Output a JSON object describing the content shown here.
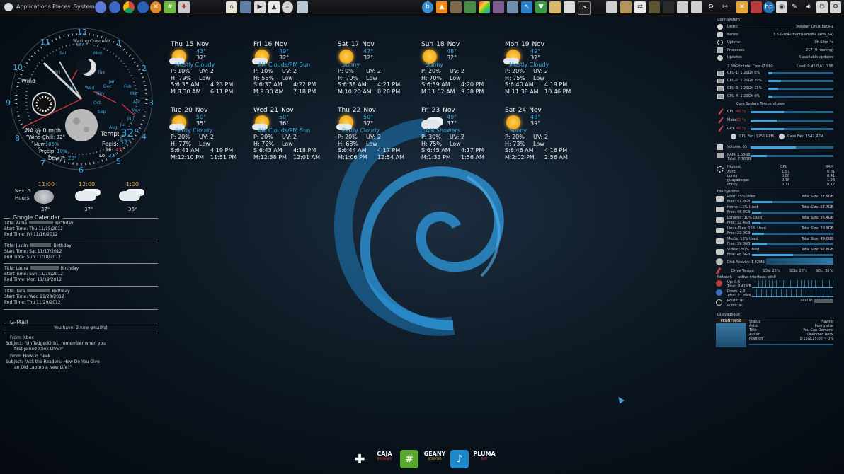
{
  "panel": {
    "menus": [
      "Applications",
      "Places",
      "System"
    ]
  },
  "clock": {
    "moon_phase": "Waxing Crescent",
    "wind_label": "Wind",
    "hour_numbers": [
      "12",
      "1",
      "2",
      "3",
      "4",
      "5",
      "6",
      "7",
      "8",
      "9",
      "10",
      "11"
    ],
    "weekday_labels": [
      "Sun",
      "Mon",
      "Tue",
      "Wed",
      "Thu",
      "Fri",
      "Sat"
    ],
    "month_labels": [
      "Jan",
      "Feb",
      "Mar",
      "Apr",
      "May",
      "Jun",
      "Jul",
      "Aug",
      "Sep",
      "Oct",
      "Nov",
      "Dec"
    ],
    "wind": "NA @ 0 mph",
    "wind_chill": "Wind Chill: 32°",
    "humidity_label": "Hum:",
    "humidity": "85%",
    "precip_label": "Precip:",
    "precip": "10%",
    "dewpoint_label": "Dew-P:",
    "dewpoint": "28°",
    "temp_label": "Temp:",
    "temp": "32°",
    "feels_label": "Feels:",
    "feels": "32°",
    "hi_label": "Hi:",
    "hi": "43°",
    "lo_label": "Lo:",
    "lo": "32°"
  },
  "hourly": {
    "label_line1": "Next 3",
    "label_line2": "Hours",
    "items": [
      {
        "time": "11:00",
        "temp": "37°"
      },
      {
        "time": "12:00",
        "temp": "37°"
      },
      {
        "time": "1:00",
        "temp": "36°"
      }
    ]
  },
  "forecast": [
    {
      "day": "Thu",
      "date": "15",
      "mon": "Nov",
      "hi": "43°",
      "lo": "32°",
      "cond": "Mostly Cloudy",
      "p": "P: 10%",
      "uv": "UV: 2",
      "h": "H: 79%",
      "uvl": "Low",
      "s": "S:6:35 AM",
      "s2": "4:23 PM",
      "m": "M:8:30 AM",
      "m2": "6:11 PM",
      "icon": "partly-cloudy"
    },
    {
      "day": "Fri",
      "date": "16",
      "mon": "Nov",
      "hi": "49°",
      "lo": "32°",
      "cond": "AM Clouds/PM Sun",
      "p": "P: 10%",
      "uv": "UV: 2",
      "h": "H: 55%",
      "uvl": "Low",
      "s": "S:6:37 AM",
      "s2": "4:22 PM",
      "m": "M:9:30 AM",
      "m2": "7:18 PM",
      "icon": "partly-cloudy"
    },
    {
      "day": "Sat",
      "date": "17",
      "mon": "Nov",
      "hi": "47°",
      "lo": "32°",
      "cond": "Sunny",
      "p": "P: 0%",
      "uv": "UV: 2",
      "h": "H: 70%",
      "uvl": "Low",
      "s": "S:6:38 AM",
      "s2": "4:21 PM",
      "m": "M:10:20 AM",
      "m2": "8:28 PM",
      "icon": "sunny"
    },
    {
      "day": "Sun",
      "date": "18",
      "mon": "Nov",
      "hi": "48°",
      "lo": "32°",
      "cond": "Sunny",
      "p": "P: 20%",
      "uv": "UV: 2",
      "h": "H: 70%",
      "uvl": "Low",
      "s": "S:6:39 AM",
      "s2": "4:20 PM",
      "m": "M:11:02 AM",
      "m2": "9:38 PM",
      "icon": "sunny"
    },
    {
      "day": "Mon",
      "date": "19",
      "mon": "Nov",
      "hi": "49°",
      "lo": "32°",
      "cond": "Mostly Cloudy",
      "p": "P: 20%",
      "uv": "UV: 2",
      "h": "H: 75%",
      "uvl": "Low",
      "s": "S:6:40 AM",
      "s2": "4:19 PM",
      "m": "M:11:38 AM",
      "m2": "10:46 PM",
      "icon": "partly-cloudy"
    },
    {
      "day": "Tue",
      "date": "20",
      "mon": "Nov",
      "hi": "50°",
      "lo": "35°",
      "cond": "Partly Cloudy",
      "p": "P: 20%",
      "uv": "UV: 2",
      "h": "H: 77%",
      "uvl": "Low",
      "s": "S:6:41 AM",
      "s2": "4:19 PM",
      "m": "M:12:10 PM",
      "m2": "11:51 PM",
      "icon": "partly-cloudy"
    },
    {
      "day": "Wed",
      "date": "21",
      "mon": "Nov",
      "hi": "50°",
      "lo": "36°",
      "cond": "AM Clouds/PM Sun",
      "p": "P: 20%",
      "uv": "UV: 2",
      "h": "H: 72%",
      "uvl": "Low",
      "s": "S:6:43 AM",
      "s2": "4:18 PM",
      "m": "M:12:38 PM",
      "m2": "12:01 AM",
      "icon": "partly-cloudy"
    },
    {
      "day": "Thu",
      "date": "22",
      "mon": "Nov",
      "hi": "50°",
      "lo": "37°",
      "cond": "Partly Cloudy",
      "p": "P: 20%",
      "uv": "UV: 2",
      "h": "H: 68%",
      "uvl": "Low",
      "s": "S:6:44 AM",
      "s2": "4:17 PM",
      "m": "M:1:06 PM",
      "m2": "12:54 AM",
      "icon": "partly-cloudy"
    },
    {
      "day": "Fri",
      "date": "23",
      "mon": "Nov",
      "hi": "49°",
      "lo": "37°",
      "cond": "AM Showers",
      "p": "P: 30%",
      "uv": "UV: 2",
      "h": "H: 75%",
      "uvl": "Low",
      "s": "S:6:45 AM",
      "s2": "4:17 PM",
      "m": "M:1:33 PM",
      "m2": "1:56 AM",
      "icon": "showers"
    },
    {
      "day": "Sat",
      "date": "24",
      "mon": "Nov",
      "hi": "48°",
      "lo": "39°",
      "cond": "Sunny",
      "p": "P: 20%",
      "uv": "UV: 2",
      "h": "H: 73%",
      "uvl": "Low",
      "s": "S:6:46 AM",
      "s2": "4:16 PM",
      "m": "M:2:02 PM",
      "m2": "2:56 AM",
      "icon": "sunny"
    }
  ],
  "calendar": {
    "title": "Google Calendar",
    "events": [
      {
        "title": "Title: Amie",
        "what": "Birthday",
        "start": "Start Time: Thu 11/15/2012",
        "end": "End Time: Fri 11/16/2012"
      },
      {
        "title": "Title: Justin",
        "what": "Birthday",
        "start": "Start Time: Sat 11/17/2012",
        "end": "End Time: Sun 11/18/2012"
      },
      {
        "title": "Title: Laura",
        "what": "Birthday",
        "start": "Start Time: Sun 11/18/2012",
        "end": "End Time: Mon 11/19/2012"
      },
      {
        "title": "Title: Tara",
        "what": "Birthday",
        "start": "Start Time: Wed 11/28/2012",
        "end": "End Time: Thu 11/29/2012"
      }
    ]
  },
  "gmail": {
    "title": "G-Mail",
    "summary": "You have: 2 new gmail(s)",
    "messages": [
      {
        "from": "From: Xbox",
        "subject": "Subject: \"UnfledgedOrb1, remember when you",
        "subject2": "first joined Xbox LIVE?\""
      },
      {
        "from": "From: How-To Geek",
        "subject": "Subject: \"Ask the Readers: How Do You Give",
        "subject2": "an Old Laptop a New Life?\""
      }
    ]
  },
  "system": {
    "title": "Core System",
    "rows": [
      {
        "k": "Distro",
        "v": "Tweaker Linux Beta-1"
      },
      {
        "k": "Kernel",
        "v": "3.6.0-rc4-ubuntu-amd64 (x86_64)"
      },
      {
        "k": "Uptime",
        "v": "0h 58m 4s"
      },
      {
        "k": "Processes",
        "v": "217 (0 running)"
      },
      {
        "k": "Updates",
        "v": "0 available updates"
      }
    ],
    "cpu_name": "2.80GHz Intel Core-i7 860",
    "load": "Load: 0.45 0.61 0.98",
    "cores": [
      {
        "label": "CPU-1: 1.20Gh 6%",
        "pct": 6
      },
      {
        "label": "CPU-2: 1.20Gh 20%",
        "pct": 20
      },
      {
        "label": "CPU-3: 1.20Gh 15%",
        "pct": 15
      },
      {
        "label": "CPU-4: 1.20Gh 6%",
        "pct": 6
      }
    ],
    "temps_title": "Core System Temperatures",
    "temps": [
      {
        "label": "CPU",
        "val": "40 °c",
        "pct": 40
      },
      {
        "label": "Mobo",
        "val": "32 °c",
        "pct": 32
      },
      {
        "label": "GFX",
        "val": "40 °c",
        "pct": 40
      }
    ],
    "cpu_fan": "CPU Fan: 1251 RPM",
    "case_fan": "Case Fan: 1542 RPM",
    "volume": "Volume: 55",
    "ram": "RAM: 1.50GB",
    "ram_total": "Total: 7.78GB",
    "highest_title": "Highest",
    "highest_cols": [
      "CPU",
      "RAM"
    ],
    "processes": [
      {
        "name": "Xorg",
        "cpu": "1.57",
        "ram": "0.81"
      },
      {
        "name": "conky",
        "cpu": "0.88",
        "ram": "0.41"
      },
      {
        "name": "guayadeque",
        "cpu": "0.76",
        "ram": "1.26"
      },
      {
        "name": "conky",
        "cpu": "0.71",
        "ram": "0.17"
      }
    ],
    "fs_title": "File Systems",
    "filesystems": [
      {
        "used": "Root: 25% Used",
        "free": "Free: 51.2GB",
        "total": "Total Size: 27.5GB",
        "pct": 25
      },
      {
        "used": "Home: 11% Used",
        "free": "Free: 48.3GB",
        "total": "Total Size: 57.7GB",
        "pct": 11
      },
      {
        "used": "LShared: 10% Used",
        "free": "Free: 32.4GB",
        "total": "Total Size: 36.4GB",
        "pct": 10
      },
      {
        "used": "Linux-Files: 15% Used",
        "free": "Free: 22.9GB",
        "total": "Total Size: 28.9GB",
        "pct": 15
      },
      {
        "used": "Media: 18% Used",
        "free": "Free: 39.8GB",
        "total": "Total Size: 49.0GB",
        "pct": 18
      },
      {
        "used": "Videos: 50% Used",
        "free": "Free: 48.6GB",
        "total": "Total Size: 97.8GB",
        "pct": 50
      }
    ],
    "disk_activity": "Disk Activity: 1.42MB",
    "drive_temps_label": "Drive Temps:",
    "drive_temps": [
      "SDa: 28°c",
      "SDb: 28°c",
      "SDc: 30°c"
    ],
    "network_label": "Network",
    "active_iface": "active interface: eth0",
    "net_rows": [
      "Up: 0.6",
      "Total: 9.41MB",
      "Down: 2.0",
      "Total: 71.8MB"
    ],
    "router": "Router IP:",
    "local": "Local IP:",
    "public": "Public IP:"
  },
  "music": {
    "title": "Guayadeque",
    "cover_text": "PENNYWISE",
    "rows": [
      {
        "k": "Status",
        "v": "Playing"
      },
      {
        "k": "Artist",
        "v": "Pennywise"
      },
      {
        "k": "Title",
        "v": "You Can Demand"
      },
      {
        "k": "Album",
        "v": "Unknown Rock"
      },
      {
        "k": "Position",
        "v": "0:15/2:25:00 ~ 0%"
      }
    ]
  },
  "dock": {
    "items": [
      {
        "name": "add",
        "label": ""
      },
      {
        "name": "caja",
        "label": "CAJA",
        "sub": "BROWSER"
      },
      {
        "name": "hashtag",
        "label": ""
      },
      {
        "name": "geany",
        "label": "GEANY",
        "sub": "SCRIPTER"
      },
      {
        "name": "music",
        "label": ""
      },
      {
        "name": "pluma",
        "label": "PLUMA",
        "sub": "TEXT"
      }
    ]
  },
  "colors": {
    "accent": "#3fa8e0",
    "background": "#0b1520",
    "bar": "#1f5f86"
  }
}
